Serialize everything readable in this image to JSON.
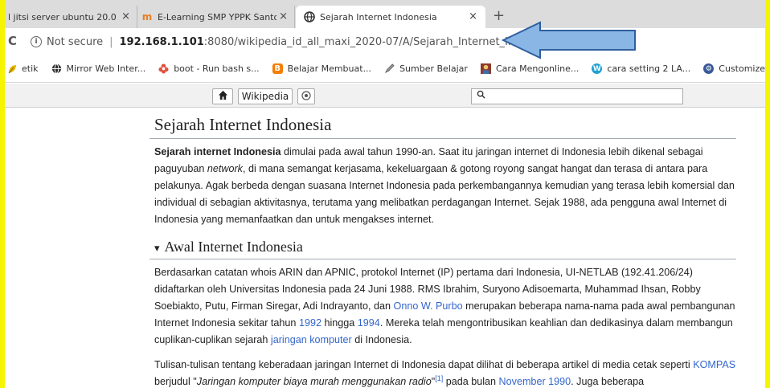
{
  "tabs": [
    {
      "title": "l jitsi server ubuntu 20.0",
      "active": false,
      "icon": "none"
    },
    {
      "title": "E-Learning SMP YPPK Santo D",
      "active": false,
      "icon": "moodle-icon"
    },
    {
      "title": "Sejarah Internet Indonesia",
      "active": true,
      "icon": "globe-icon"
    }
  ],
  "tab_close": "×",
  "new_tab": "+",
  "omnibox": {
    "not_secure": "Not secure",
    "separator": "|",
    "host": "192.168.1.101",
    "path": ":8080/wikipedia_id_all_maxi_2020-07/A/Sejarah_Internet_Indonesia"
  },
  "reload_glyph": "C",
  "bookmarks": [
    {
      "label": "etik",
      "icon": "leaf-icon",
      "color": "#e6b800"
    },
    {
      "label": "Mirror Web Inter...",
      "icon": "globe-icon",
      "color": "#333333"
    },
    {
      "label": "boot - Run bash s...",
      "icon": "flower-icon",
      "color": "#e0503a"
    },
    {
      "label": "Belajar Membuat...",
      "icon": "blogger-icon",
      "color": "#f57d00"
    },
    {
      "label": "Sumber Belajar",
      "icon": "pen-icon",
      "color": "#7a7a7a"
    },
    {
      "label": "Cara Mengonline...",
      "icon": "image-icon",
      "color": "#c0392b"
    },
    {
      "label": "cara setting 2 LA...",
      "icon": "wordpress-icon",
      "color": "#21a0d2"
    },
    {
      "label": "Customize",
      "icon": "settings-icon",
      "color": "#3b5998"
    }
  ],
  "wiki_header": {
    "home_icon": "home-icon",
    "site_label": "Wikipedia",
    "random_icon": "dice-icon",
    "search_placeholder": ""
  },
  "article": {
    "title": "Sejarah Internet Indonesia",
    "intro": {
      "bold": "Sejarah internet Indonesia",
      "t1": " dimulai pada awal tahun 1990-an. Saat itu jaringan internet di Indonesia lebih dikenal sebagai paguyuban ",
      "italic": "network",
      "t2": ", di mana semangat kerjasama, kekeluargaan & gotong royong sangat hangat dan terasa di antara para pelakunya. Agak berbeda dengan suasana Internet Indonesia pada perkembangannya kemudian yang terasa lebih komersial dan individual di sebagian aktivitasnya, terutama yang melibatkan perdagangan Internet. Sejak 1988, ada pengguna awal Internet di Indonesia yang memanfaatkan dan untuk mengakses internet."
    },
    "section1": {
      "heading": "Awal Internet Indonesia",
      "toggle": "▾",
      "p1": {
        "t1": "Berdasarkan catatan whois ARIN dan APNIC, protokol Internet (IP) pertama dari Indonesia, UI-NETLAB (192.41.206/24) didaftarkan oleh Universitas Indonesia pada 24 Juni 1988. RMS Ibrahim, Suryono Adisoemarta, Muhammad Ihsan, Robby Soebiakto, Putu, Firman Siregar, Adi Indrayanto, dan ",
        "link1": "Onno W. Purbo",
        "t2": " merupakan beberapa nama-nama pada awal pembangunan Internet Indonesia sekitar tahun ",
        "link2": "1992",
        "t3": " hingga ",
        "link3": "1994",
        "t4": ". Mereka telah mengontribusikan keahlian dan dedikasinya dalam membangun cuplikan-cuplikan sejarah ",
        "link4": "jaringan komputer",
        "t5": " di Indonesia."
      },
      "p2": {
        "t1": "Tulisan-tulisan tentang keberadaan jaringan Internet di Indonesia dapat dilihat di beberapa artikel di media cetak seperti ",
        "link1": "KOMPAS",
        "t2": " berjudul \"",
        "italic": "Jaringan komputer biaya murah menggunakan radio",
        "t3": "\"",
        "ref": "[1]",
        "t4": " pada bulan ",
        "link2": "November 1990",
        "t5": ". Juga beberapa"
      }
    }
  },
  "colors": {
    "frame": "#f6f500",
    "link": "#3366cc",
    "arrow_fill": "#8ab6e6",
    "arrow_stroke": "#2f5f9e"
  }
}
